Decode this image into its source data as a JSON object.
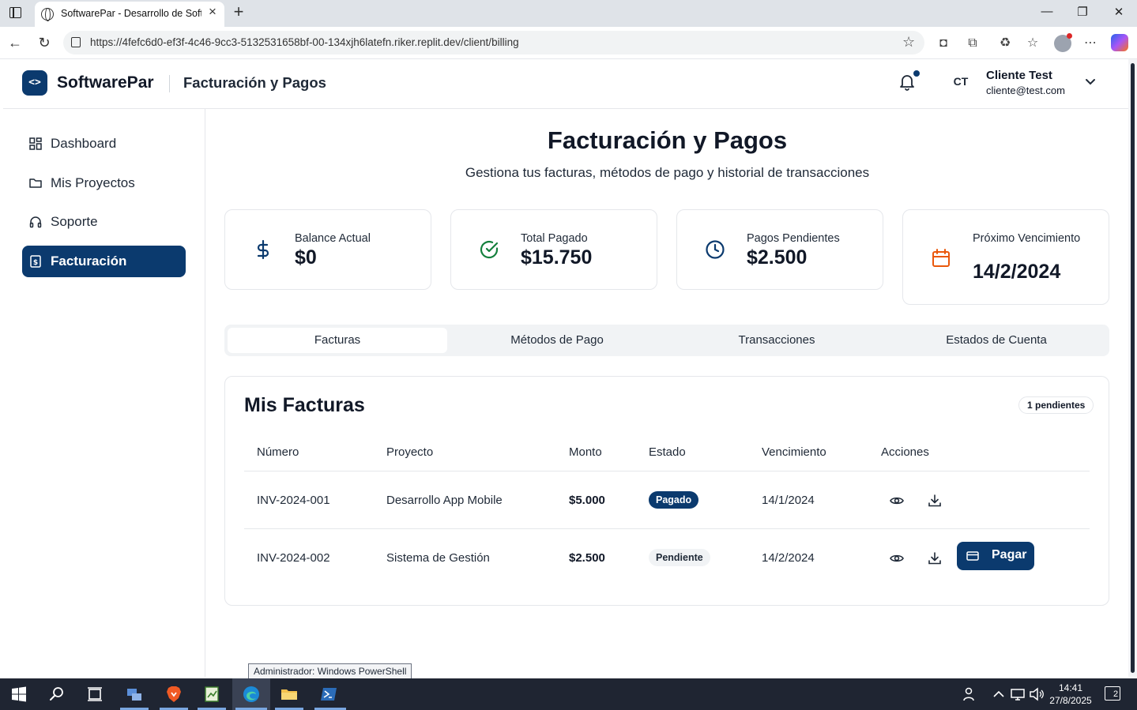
{
  "browser": {
    "tab_title": "SoftwarePar - Desarrollo de Software",
    "url": "https://4fefc6d0-ef3f-4c46-9cc3-5132531658bf-00-134xjh6latefn.riker.replit.dev/client/billing"
  },
  "header": {
    "logo_glyph": "<>",
    "brand": "SoftwarePar",
    "title": "Facturación y Pagos",
    "user_initials": "CT",
    "user_name": "Cliente Test",
    "user_email": "cliente@test.com"
  },
  "sidebar": {
    "items": [
      {
        "label": "Dashboard",
        "icon": "dashboard-icon",
        "active": false
      },
      {
        "label": "Mis Proyectos",
        "icon": "folder-icon",
        "active": false
      },
      {
        "label": "Soporte",
        "icon": "headphones-icon",
        "active": false
      },
      {
        "label": "Facturación",
        "icon": "receipt-icon",
        "active": true
      }
    ]
  },
  "main": {
    "title": "Facturación y Pagos",
    "subtitle": "Gestiona tus facturas, métodos de pago y historial de transacciones",
    "stats": [
      {
        "label": "Balance Actual",
        "value": "$0",
        "icon": "dollar-icon",
        "color": "#0b3a6e"
      },
      {
        "label": "Total Pagado",
        "value": "$15.750",
        "icon": "check-circle-icon",
        "color": "#15803d"
      },
      {
        "label": "Pagos Pendientes",
        "value": "$2.500",
        "icon": "clock-icon",
        "color": "#0b3a6e"
      },
      {
        "label": "Próximo Vencimiento",
        "value": "14/2/2024",
        "icon": "calendar-icon",
        "color": "#ea580c"
      }
    ],
    "tabs": [
      {
        "label": "Facturas",
        "active": true
      },
      {
        "label": "Métodos de Pago",
        "active": false
      },
      {
        "label": "Transacciones",
        "active": false
      },
      {
        "label": "Estados de Cuenta",
        "active": false
      }
    ],
    "invoices": {
      "title": "Mis Facturas",
      "pending_badge": "1 pendientes",
      "columns": [
        "Número",
        "Proyecto",
        "Monto",
        "Estado",
        "Vencimiento",
        "Acciones"
      ],
      "rows": [
        {
          "number": "INV-2024-001",
          "project": "Desarrollo App Mobile",
          "amount": "$5.000",
          "status": "Pagado",
          "due": "14/1/2024"
        },
        {
          "number": "INV-2024-002",
          "project": "Sistema de Gestión",
          "amount": "$2.500",
          "status": "Pendiente",
          "due": "14/2/2024",
          "pay_label": "Pagar"
        }
      ]
    }
  },
  "tooltip": "Administrador: Windows PowerShell",
  "taskbar": {
    "time": "14:41",
    "date": "27/8/2025",
    "notification_count": "2"
  },
  "colors": {
    "primary": "#0b3a6e",
    "success": "#15803d",
    "warning": "#ea580c"
  }
}
